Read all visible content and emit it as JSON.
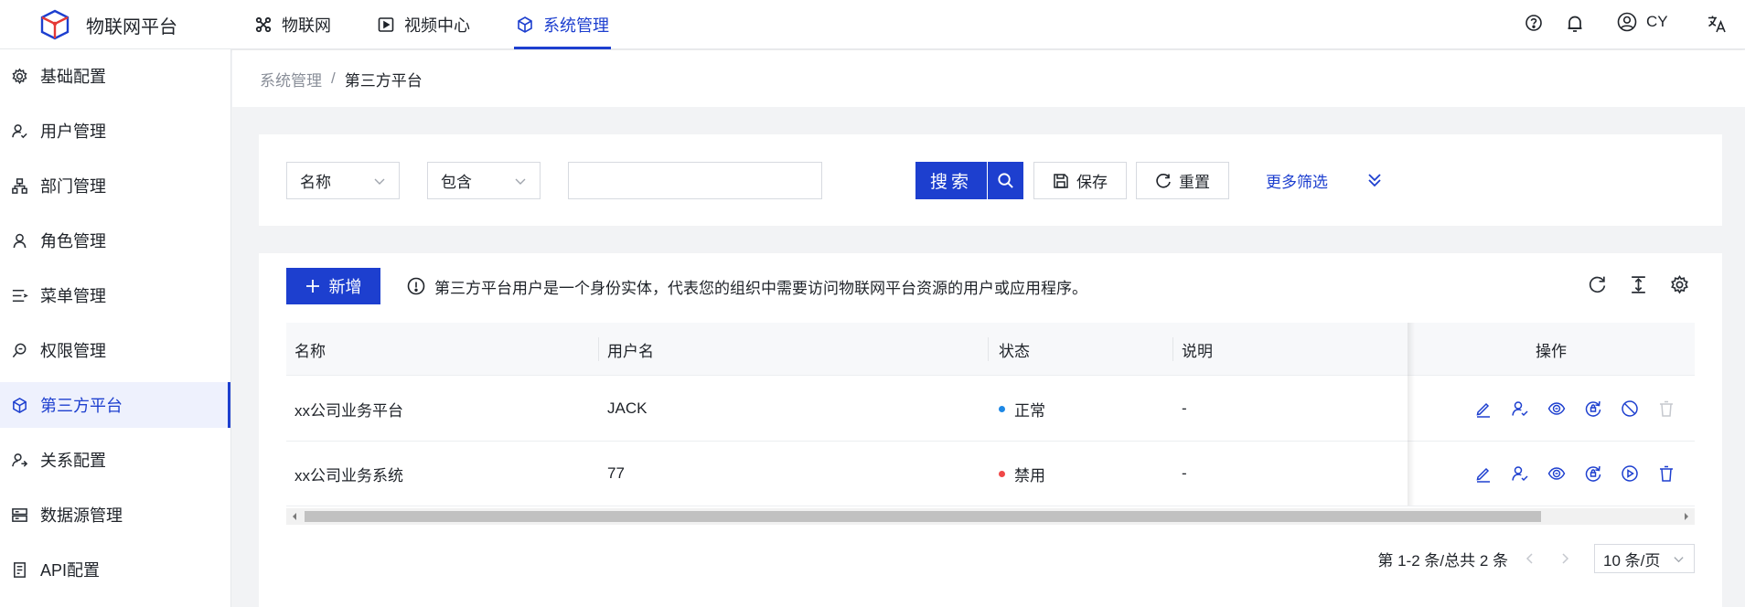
{
  "app": {
    "name": "物联网平台"
  },
  "topnav": [
    {
      "label": "物联网",
      "icon": "iot-icon",
      "active": false
    },
    {
      "label": "视频中心",
      "icon": "video-icon",
      "active": false
    },
    {
      "label": "系统管理",
      "icon": "cube-icon",
      "active": true
    }
  ],
  "user": {
    "name": "CY"
  },
  "sidebar": {
    "items": [
      {
        "label": "基础配置"
      },
      {
        "label": "用户管理"
      },
      {
        "label": "部门管理"
      },
      {
        "label": "角色管理"
      },
      {
        "label": "菜单管理"
      },
      {
        "label": "权限管理"
      },
      {
        "label": "第三方平台",
        "active": true
      },
      {
        "label": "关系配置"
      },
      {
        "label": "数据源管理"
      },
      {
        "label": "API配置"
      }
    ]
  },
  "breadcrumb": {
    "parent": "系统管理",
    "separator": "/",
    "current": "第三方平台"
  },
  "filter": {
    "field": "名称",
    "operator": "包含",
    "keyword": "",
    "search_label": "搜索",
    "save_label": "保存",
    "reset_label": "重置",
    "more_label": "更多筛选"
  },
  "toolbar": {
    "add_label": "新增",
    "notice": "第三方平台用户是一个身份实体，代表您的组织中需要访问物联网平台资源的用户或应用程序。"
  },
  "table": {
    "columns": [
      "名称",
      "用户名",
      "状态",
      "说明",
      "操作"
    ],
    "rows": [
      {
        "name": "xx公司业务平台",
        "username": "JACK",
        "status": "正常",
        "status_color": "#1e88e5",
        "desc": "-"
      },
      {
        "name": "xx公司业务系统",
        "username": "77",
        "status": "禁用",
        "status_color": "#f04848",
        "desc": "-"
      }
    ]
  },
  "pagination": {
    "summary": "第 1-2 条/总共 2 条",
    "page_size": "10 条/页"
  },
  "colors": {
    "primary": "#1d3fcf",
    "active_bg": "#eef1fd"
  }
}
